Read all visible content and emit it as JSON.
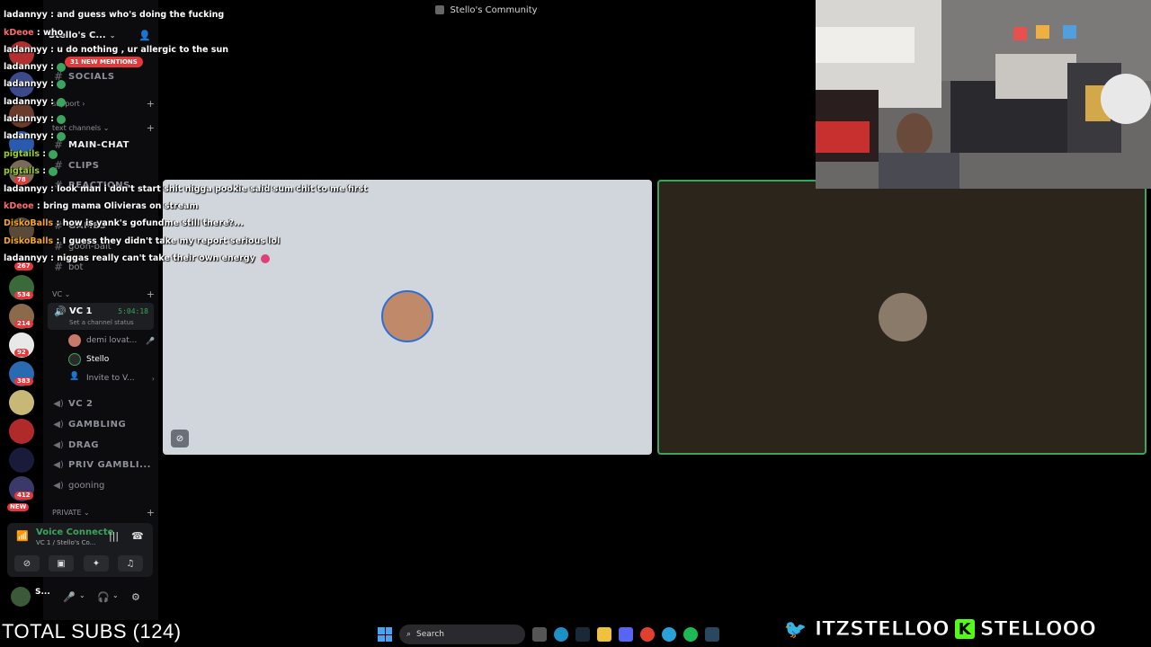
{
  "window": {
    "title": "Stello's Community"
  },
  "sidebar": {
    "server_name": "Stello's C...",
    "mentions_badge": "31 NEW MENTIONS",
    "channels_top": [
      {
        "label": "SOCIALS",
        "type": "text"
      }
    ],
    "category_support": "support",
    "category_text": "text channels",
    "text_channels": [
      {
        "label": "MAIN-CHAT"
      },
      {
        "label": "CLIPS"
      },
      {
        "label": "REACTIONS"
      },
      {
        "label": "GAMES"
      },
      {
        "label": "goon-bait"
      },
      {
        "label": "bot"
      }
    ],
    "category_vc": "VC",
    "active_voice": {
      "label": "VC 1",
      "timer": "5:04:18",
      "status": "Set a channel status"
    },
    "voice_members": [
      {
        "name": "demi lovat..."
      },
      {
        "name": "Stello"
      },
      {
        "name": "Invite to V..."
      }
    ],
    "voice_channels": [
      {
        "label": "VC 2"
      },
      {
        "label": "GAMBLING"
      },
      {
        "label": "DRAG"
      },
      {
        "label": "PRIV GAMBLI..."
      },
      {
        "label": "gooning"
      }
    ],
    "category_private": "PRIVATE",
    "voice_panel": {
      "status": "Voice Connecte",
      "channel": "VC 1 / Stello's Co..."
    },
    "user_panel": {
      "name": "S..."
    }
  },
  "rail": {
    "badges": [
      "78",
      "267",
      "534",
      "214",
      "92",
      "383",
      "412",
      "NEW"
    ]
  },
  "chat": [
    {
      "user": "ladannyy",
      "text": "and guess who's doing the fucking",
      "user_color": "#ffffff"
    },
    {
      "user": "kDeoe",
      "text": "who",
      "user_color": "#ff6b6b"
    },
    {
      "user": "ladannyy",
      "text": "u do nothing , ur allergic to the sun",
      "user_color": "#ffffff"
    },
    {
      "user": "ladannyy",
      "text": "",
      "user_color": "#ffffff",
      "emote": true
    },
    {
      "user": "ladannyy",
      "text": "",
      "user_color": "#ffffff",
      "emote": true
    },
    {
      "user": "ladannyy",
      "text": "",
      "user_color": "#ffffff",
      "emote": true
    },
    {
      "user": "ladannyy",
      "text": "",
      "user_color": "#ffffff",
      "emote": true
    },
    {
      "user": "ladannyy",
      "text": "",
      "user_color": "#ffffff",
      "emote": true
    },
    {
      "user": "pigtails",
      "text": "",
      "user_color": "#9acd32",
      "emote": true
    },
    {
      "user": "pigtails",
      "text": "",
      "user_color": "#9acd32",
      "emote": true
    },
    {
      "user": "ladannyy",
      "text": "look man i don't start shit nigga pookie said sum chit to me first",
      "user_color": "#ffffff"
    },
    {
      "user": "kDeoe",
      "text": "bring mama Olivieras on stream",
      "user_color": "#ff6b6b"
    },
    {
      "user": "DiskoBalls",
      "text": "how is yank's gofundme still there?...",
      "user_color": "#f5a623"
    },
    {
      "user": "DiskoBalls",
      "text": "I guess they didn't take my report serious lol",
      "user_color": "#f5a623"
    },
    {
      "user": "ladannyy",
      "text": "niggas really can't take their own energy",
      "user_color": "#ffffff"
    }
  ],
  "overlay": {
    "total_subs": "TOTAL SUBS (124)",
    "twitter_handle": "ITZSTELLOO",
    "kick_handle": "STELLOOO",
    "kick_icon": "K"
  },
  "taskbar": {
    "search_placeholder": "Search"
  },
  "colors": {
    "accent_green": "#3ba55d",
    "mention_red": "#e5383b",
    "kick_green": "#53fc18"
  }
}
